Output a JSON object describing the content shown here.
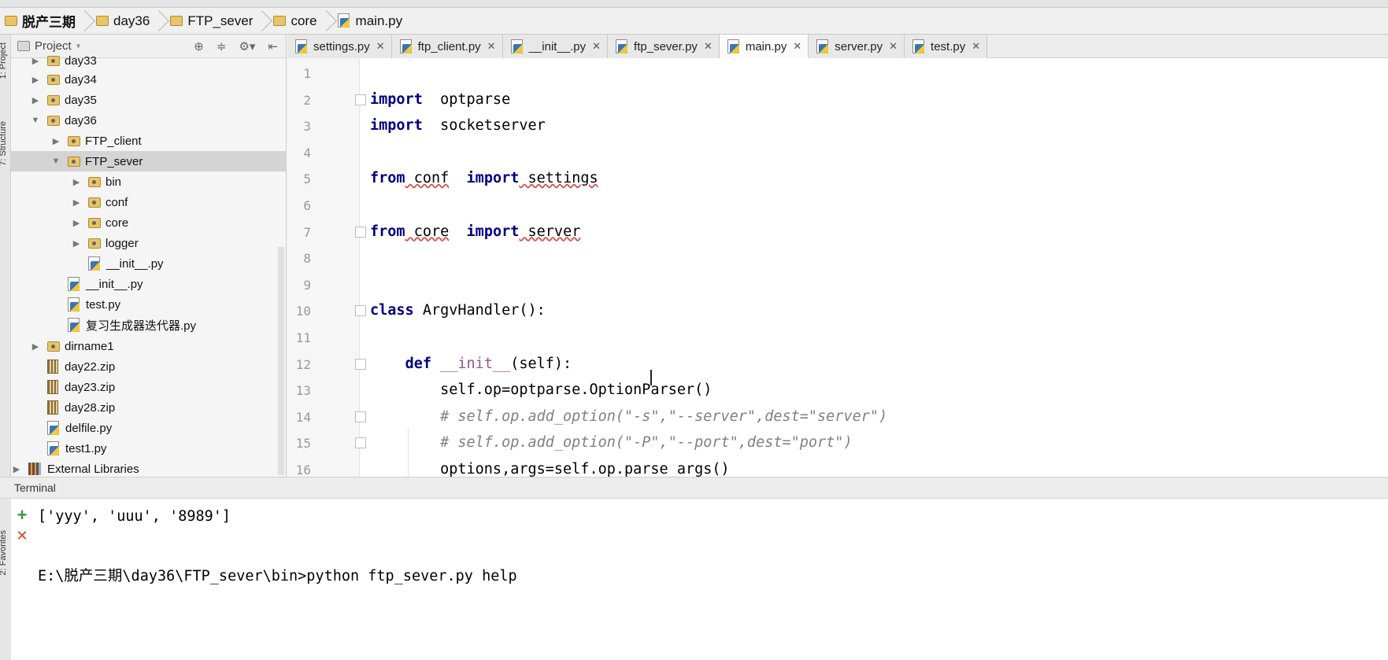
{
  "breadcrumb": [
    {
      "label": "脱产三期",
      "icon": "folder-icon"
    },
    {
      "label": "day36",
      "icon": "folder-icon"
    },
    {
      "label": "FTP_sever",
      "icon": "folder-icon"
    },
    {
      "label": "core",
      "icon": "folder-icon"
    },
    {
      "label": "main.py",
      "icon": "python-file-icon"
    }
  ],
  "project_panel": {
    "title": "Project",
    "tree": [
      {
        "label": "day33",
        "type": "folder",
        "depth": 0,
        "expanded": false
      },
      {
        "label": "day34",
        "type": "folder",
        "depth": 0,
        "expanded": false
      },
      {
        "label": "day35",
        "type": "folder",
        "depth": 0,
        "expanded": false
      },
      {
        "label": "day36",
        "type": "folder",
        "depth": 0,
        "expanded": true
      },
      {
        "label": "FTP_client",
        "type": "folder",
        "depth": 1,
        "expanded": false
      },
      {
        "label": "FTP_sever",
        "type": "folder",
        "depth": 1,
        "expanded": true,
        "selected": true
      },
      {
        "label": "bin",
        "type": "folder",
        "depth": 2,
        "expanded": false
      },
      {
        "label": "conf",
        "type": "folder",
        "depth": 2,
        "expanded": false
      },
      {
        "label": "core",
        "type": "folder",
        "depth": 2,
        "expanded": false
      },
      {
        "label": "logger",
        "type": "folder",
        "depth": 2,
        "expanded": false
      },
      {
        "label": "__init__.py",
        "type": "py",
        "depth": 2
      },
      {
        "label": "__init__.py",
        "type": "py",
        "depth": 1
      },
      {
        "label": "test.py",
        "type": "py",
        "depth": 1
      },
      {
        "label": "复习生成器迭代器.py",
        "type": "py",
        "depth": 1
      },
      {
        "label": "dirname1",
        "type": "folder",
        "depth": 0,
        "expanded": false
      },
      {
        "label": "day22.zip",
        "type": "zip",
        "depth": 0
      },
      {
        "label": "day23.zip",
        "type": "zip",
        "depth": 0
      },
      {
        "label": "day28.zip",
        "type": "zip",
        "depth": 0
      },
      {
        "label": "delfile.py",
        "type": "py",
        "depth": 0
      },
      {
        "label": "test1.py",
        "type": "py",
        "depth": 0
      },
      {
        "label": "External Libraries",
        "type": "lib",
        "depth": -1,
        "expanded": false
      }
    ]
  },
  "tabs": [
    {
      "label": "settings.py",
      "active": false
    },
    {
      "label": "ftp_client.py",
      "active": false
    },
    {
      "label": "__init__.py",
      "active": false
    },
    {
      "label": "ftp_sever.py",
      "active": false
    },
    {
      "label": "main.py",
      "active": true
    },
    {
      "label": "server.py",
      "active": false
    },
    {
      "label": "test.py",
      "active": false
    }
  ],
  "code_lines": [
    {
      "n": "1",
      "parts": []
    },
    {
      "n": "2",
      "parts": [
        [
          "kw",
          "import"
        ],
        [
          "",
          "  optparse"
        ]
      ]
    },
    {
      "n": "3",
      "parts": [
        [
          "kw",
          "import"
        ],
        [
          "",
          "  socketserver"
        ]
      ]
    },
    {
      "n": "4",
      "parts": []
    },
    {
      "n": "5",
      "parts": [
        [
          "kw",
          "from"
        ],
        [
          "sq",
          " conf"
        ],
        [
          "kw",
          "  import"
        ],
        [
          "sq",
          " settings"
        ]
      ]
    },
    {
      "n": "6",
      "parts": []
    },
    {
      "n": "7",
      "parts": [
        [
          "kw",
          "from"
        ],
        [
          "sq",
          " core"
        ],
        [
          "kw",
          "  import"
        ],
        [
          "sq",
          " server"
        ]
      ]
    },
    {
      "n": "8",
      "parts": []
    },
    {
      "n": "9",
      "parts": []
    },
    {
      "n": "10",
      "parts": [
        [
          "kw",
          "class"
        ],
        [
          "",
          " ArgvHandler():"
        ]
      ]
    },
    {
      "n": "11",
      "parts": []
    },
    {
      "n": "12",
      "parts": [
        [
          "",
          "    "
        ],
        [
          "kw",
          "def"
        ],
        [
          "",
          " "
        ],
        [
          "dec",
          "__init__"
        ],
        [
          "",
          "(self):"
        ]
      ]
    },
    {
      "n": "13",
      "parts": [
        [
          "",
          "        self.op=optparse.OptionParser()"
        ]
      ]
    },
    {
      "n": "14",
      "parts": [
        [
          "cm",
          "        # self.op.add_option(\"-s\",\"--server\",dest=\"server\")"
        ]
      ]
    },
    {
      "n": "15",
      "parts": [
        [
          "cm",
          "        # self.op.add_option(\"-P\",\"--port\",dest=\"port\")"
        ]
      ]
    },
    {
      "n": "16",
      "parts": [
        [
          "",
          "        options,args=self.op.parse_args()"
        ]
      ]
    }
  ],
  "terminal": {
    "title": "Terminal",
    "lines": [
      "['yyy', 'uuu', '8989']",
      "",
      "E:\\脱产三期\\day36\\FTP_sever\\bin>python ftp_sever.py help"
    ],
    "add_label": "+",
    "close_label": "✕"
  },
  "side_labels": {
    "project": "1: Project",
    "structure": "7: Structure",
    "favorites": "2: Favorites"
  }
}
